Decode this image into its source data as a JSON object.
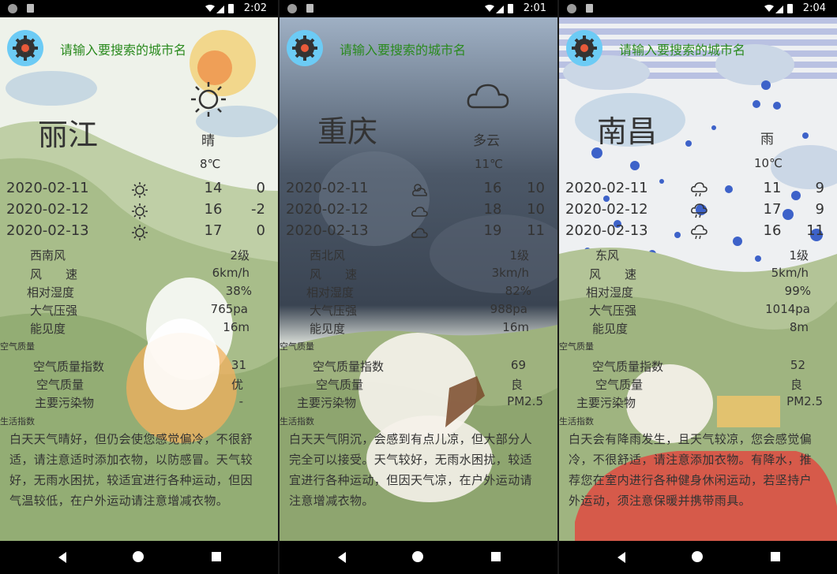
{
  "phones": [
    {
      "time": "2:02",
      "search_placeholder": "请输入要搜索的城市名",
      "city": "丽江",
      "condition": "晴",
      "temperature": "8℃",
      "weather_icon": "sun-icon",
      "forecast": [
        {
          "date": "2020-02-11",
          "icon": "sun-icon",
          "high": "14",
          "low": "0"
        },
        {
          "date": "2020-02-12",
          "icon": "sun-icon",
          "high": "16",
          "low": "-2"
        },
        {
          "date": "2020-02-13",
          "icon": "sun-icon",
          "high": "17",
          "low": "0"
        }
      ],
      "details": [
        {
          "label": "西南风",
          "value": "2级"
        },
        {
          "label": "风　　速",
          "value": "6km/h"
        },
        {
          "label": "相对湿度",
          "value": "38%"
        },
        {
          "label": "大气压强",
          "value": "765pa"
        },
        {
          "label": "能见度",
          "value": "16m"
        }
      ],
      "aq_title": "空气质量",
      "aq": [
        {
          "label": "空气质量指数",
          "value": "31"
        },
        {
          "label": "空气质量",
          "value": "优"
        },
        {
          "label": "主要污染物",
          "value": "-"
        }
      ],
      "life_title": "生活指数",
      "life": "白天天气晴好，但仍会使您感觉偏冷，不很舒适，请注意适时添加衣物，以防感冒。天气较好，无雨水困扰，较适宜进行各种运动，但因气温较低，在户外运动请注意增减衣物。",
      "bg_top": "#eaf0e4",
      "bg_bottom": "#9bb37f"
    },
    {
      "time": "2:01",
      "search_placeholder": "请输入要搜索的城市名",
      "city": "重庆",
      "condition": "多云",
      "temperature": "11℃",
      "weather_icon": "cloud-icon",
      "forecast": [
        {
          "date": "2020-02-11",
          "icon": "partly-cloudy-icon",
          "high": "16",
          "low": "10"
        },
        {
          "date": "2020-02-12",
          "icon": "cloud-icon",
          "high": "18",
          "low": "10"
        },
        {
          "date": "2020-02-13",
          "icon": "cloud-icon",
          "high": "19",
          "low": "11"
        }
      ],
      "details": [
        {
          "label": "西北风",
          "value": "1级"
        },
        {
          "label": "风　　速",
          "value": "3km/h"
        },
        {
          "label": "相对湿度",
          "value": "82%"
        },
        {
          "label": "大气压强",
          "value": "988pa"
        },
        {
          "label": "能见度",
          "value": "16m"
        }
      ],
      "aq_title": "空气质量",
      "aq": [
        {
          "label": "空气质量指数",
          "value": "69"
        },
        {
          "label": "空气质量",
          "value": "良"
        },
        {
          "label": "主要污染物",
          "value": "PM2.5"
        }
      ],
      "life_title": "生活指数",
      "life": "白天天气阴沉，会感到有点儿凉，但大部分人完全可以接受。天气较好，无雨水困扰，较适宜进行各种运动，但因天气凉，在户外运动请注意增减衣物。",
      "bg_top": "#3d4a5a",
      "bg_bottom": "#8fa870"
    },
    {
      "time": "2:04",
      "search_placeholder": "请输入要搜索的城市名",
      "city": "南昌",
      "condition": "雨",
      "temperature": "10℃",
      "weather_icon": "rain-icon",
      "forecast": [
        {
          "date": "2020-02-11",
          "icon": "rain-icon",
          "high": "11",
          "low": "9"
        },
        {
          "date": "2020-02-12",
          "icon": "rain-icon",
          "high": "17",
          "low": "9"
        },
        {
          "date": "2020-02-13",
          "icon": "rain-icon",
          "high": "16",
          "low": "11"
        }
      ],
      "details": [
        {
          "label": "东风",
          "value": "1级"
        },
        {
          "label": "风　　速",
          "value": "5km/h"
        },
        {
          "label": "相对湿度",
          "value": "99%"
        },
        {
          "label": "大气压强",
          "value": "1014pa"
        },
        {
          "label": "能见度",
          "value": "8m"
        }
      ],
      "aq_title": "空气质量",
      "aq": [
        {
          "label": "空气质量指数",
          "value": "52"
        },
        {
          "label": "空气质量",
          "value": "良"
        },
        {
          "label": "主要污染物",
          "value": "PM2.5"
        }
      ],
      "life_title": "生活指数",
      "life": "白天会有降雨发生，且天气较凉，您会感觉偏冷，不很舒适，请注意添加衣物。有降水，推荐您在室内进行各种健身休闲运动，若坚持户外运动，须注意保暖并携带雨具。",
      "bg_top": "#cdd3ea",
      "bg_bottom": "#8fa870"
    }
  ]
}
